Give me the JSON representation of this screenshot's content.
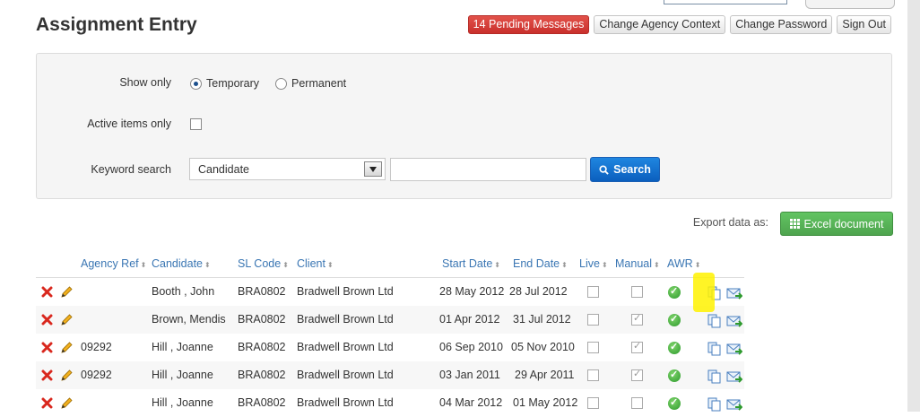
{
  "page_title": "Assignment Entry",
  "top_buttons": {
    "pending": "14 Pending Messages",
    "agency": "Change Agency Context",
    "password": "Change Password",
    "signout": "Sign Out"
  },
  "filters": {
    "show_only_label": "Show only",
    "temporary_label": "Temporary",
    "permanent_label": "Permanent",
    "active_label": "Active items only",
    "keyword_label": "Keyword search",
    "keyword_field": "Candidate",
    "keyword_value": "",
    "search_label": "Search"
  },
  "export": {
    "label": "Export data as:",
    "excel_label": "Excel document"
  },
  "table": {
    "headers": {
      "agency_ref": "Agency Ref",
      "candidate": "Candidate",
      "sl_code": "SL Code",
      "client": "Client",
      "start_date": "Start Date",
      "end_date": "End Date",
      "live": "Live",
      "manual": "Manual",
      "awr": "AWR"
    },
    "rows": [
      {
        "agency_ref": "",
        "candidate": "Booth , John",
        "sl_code": "BRA0802",
        "client": "Bradwell Brown Ltd",
        "start_date": "28 May 2012",
        "end_date": "28 Jul 2012",
        "live": false,
        "manual": false,
        "awr": true
      },
      {
        "agency_ref": "",
        "candidate": "Brown, Mendis",
        "sl_code": "BRA0802",
        "client": "Bradwell Brown Ltd",
        "start_date": "01 Apr 2012",
        "end_date": "31 Jul 2012",
        "live": false,
        "manual": true,
        "awr": true
      },
      {
        "agency_ref": "09292",
        "candidate": "Hill , Joanne",
        "sl_code": "BRA0802",
        "client": "Bradwell Brown Ltd",
        "start_date": "06 Sep 2010",
        "end_date": "05 Nov 2010",
        "live": false,
        "manual": true,
        "awr": true
      },
      {
        "agency_ref": "09292",
        "candidate": "Hill , Joanne",
        "sl_code": "BRA0802",
        "client": "Bradwell Brown Ltd",
        "start_date": "03 Jan 2011",
        "end_date": "29 Apr 2011",
        "live": false,
        "manual": true,
        "awr": true
      },
      {
        "agency_ref": "",
        "candidate": "Hill , Joanne",
        "sl_code": "BRA0802",
        "client": "Bradwell Brown Ltd",
        "start_date": "04 Mar 2012",
        "end_date": "01 May 2012",
        "live": false,
        "manual": false,
        "awr": true
      }
    ]
  },
  "colors": {
    "link": "#3a76b3",
    "danger": "#c9302c",
    "primary": "#0b5fbe",
    "success": "#4ea44e",
    "highlight": "#fff200"
  }
}
